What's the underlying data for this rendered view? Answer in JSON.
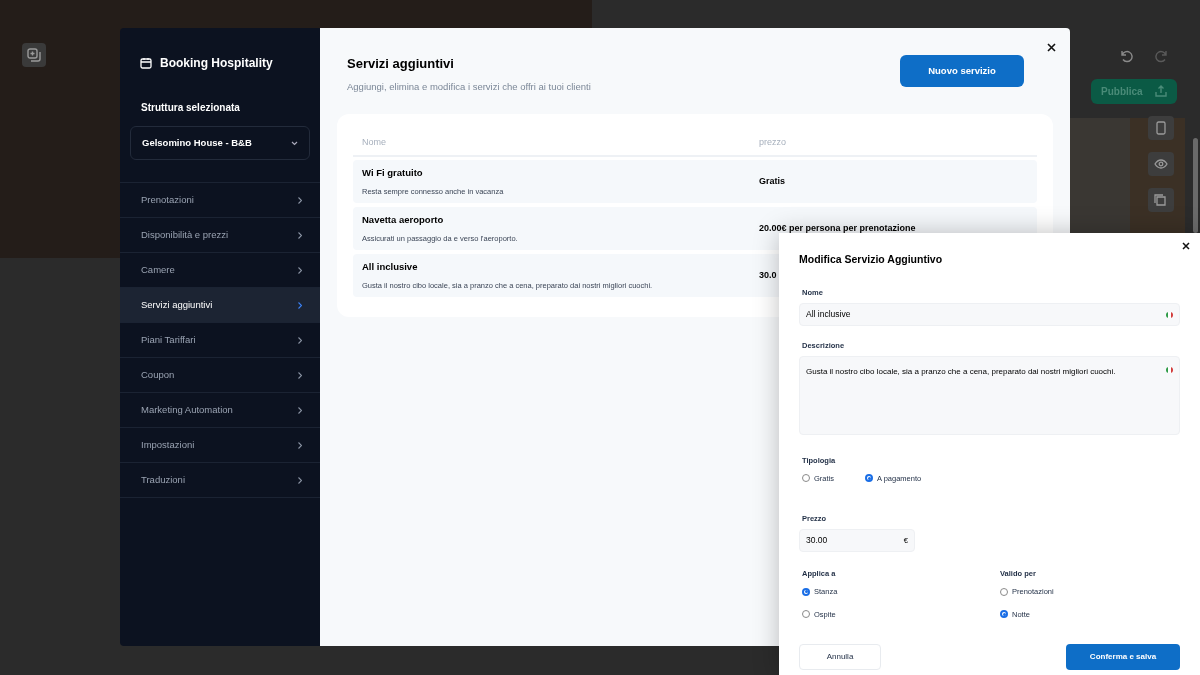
{
  "editor": {
    "publish_button": "Pubblica"
  },
  "sidebar": {
    "title": "Booking Hospitality",
    "property_label": "Struttura selezionata",
    "property_select": "Gelsomino House - B&B",
    "items": [
      {
        "label": "Prenotazioni",
        "selected": false
      },
      {
        "label": "Disponibilità e prezzi",
        "selected": false
      },
      {
        "label": "Camere",
        "selected": false
      },
      {
        "label": "Servizi aggiuntivi",
        "selected": true
      },
      {
        "label": "Piani Tariffari",
        "selected": false
      },
      {
        "label": "Coupon",
        "selected": false
      },
      {
        "label": "Marketing Automation",
        "selected": false
      },
      {
        "label": "Impostazioni",
        "selected": false
      },
      {
        "label": "Traduzioni",
        "selected": false
      }
    ]
  },
  "main": {
    "title": "Servizi aggiuntivi",
    "subtitle": "Aggiungi, elimina e modifica i servizi che offri ai tuoi clienti",
    "new_button": "Nuovo servizio",
    "table": {
      "columns": [
        "Nome",
        "prezzo"
      ],
      "rows": [
        {
          "name": "Wi Fi gratuito",
          "description": "Resta sempre connesso anche in vacanza",
          "price": "Gratis"
        },
        {
          "name": "Navetta aeroporto",
          "description": "Assicurati un passaggio da e verso l'aeroporto.",
          "price": "20.00€ per persona per prenotazione"
        },
        {
          "name": "All inclusive",
          "description": "Gusta il nostro cibo locale, sia a pranzo che a cena, preparato dai nostri migliori cuochi.",
          "price": "30.0"
        }
      ]
    }
  },
  "edit_panel": {
    "title": "Modifica Servizio Aggiuntivo",
    "name_label": "Nome",
    "name_value": "All inclusive",
    "description_label": "Descrizione",
    "description_value": "Gusta il nostro cibo locale, sia a pranzo che a cena, preparato dai nostri migliori cuochi.",
    "type_label": "Tipologia",
    "type_options": [
      {
        "label": "Gratis",
        "selected": false
      },
      {
        "label": "A pagamento",
        "selected": true
      }
    ],
    "price_label": "Prezzo",
    "price_value": "30.00",
    "currency": "€",
    "apply_label": "Applica a",
    "apply_options": [
      {
        "label": "Stanza",
        "selected": true
      },
      {
        "label": "Ospite",
        "selected": false
      }
    ],
    "valid_label": "Valido per",
    "valid_options": [
      {
        "label": "Prenotazioni",
        "selected": false
      },
      {
        "label": "Notte",
        "selected": true
      }
    ],
    "cancel_button": "Annulla",
    "confirm_button": "Conferma e salva"
  }
}
